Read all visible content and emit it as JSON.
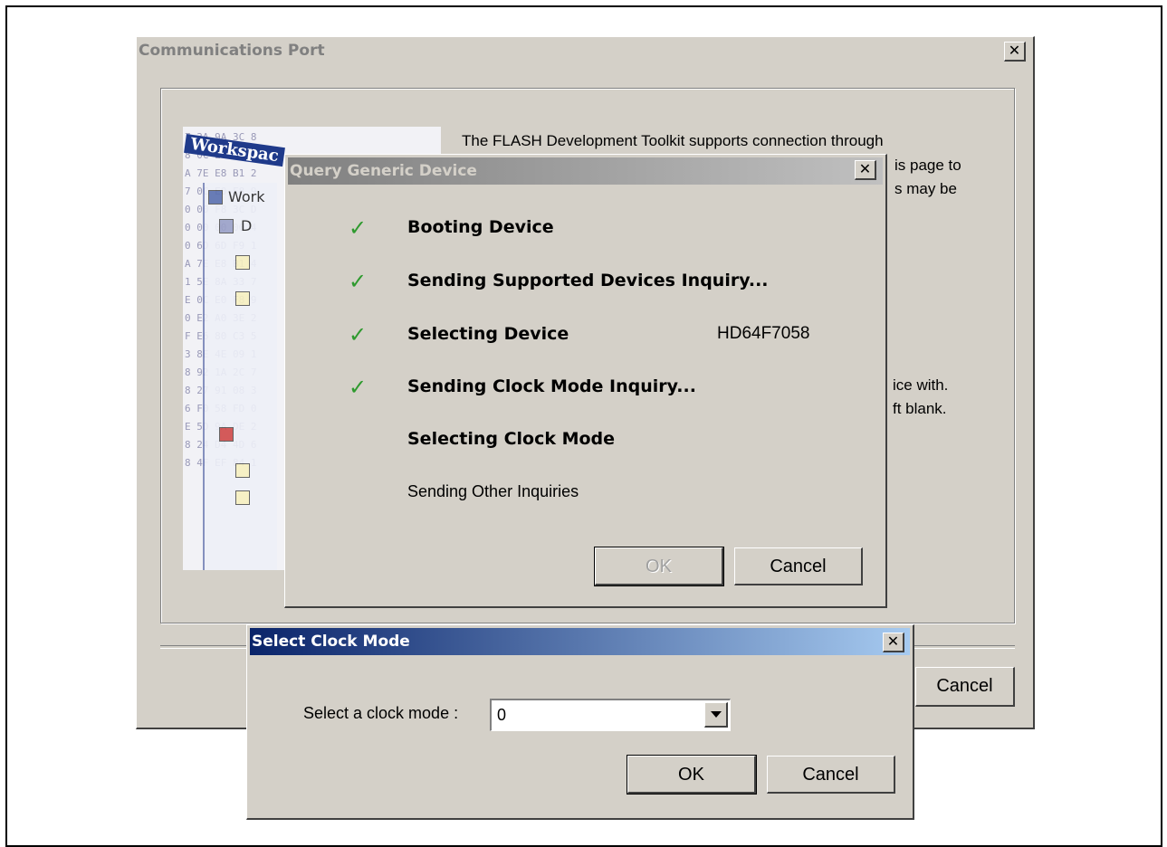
{
  "comm_port": {
    "title": "Communications Port",
    "close_glyph": "✕",
    "description_lines": [
      "The FLASH Development Toolkit supports connection through",
      "is page to",
      "s may be",
      "ice with.",
      "ft blank."
    ],
    "workspace_label": "Workspac",
    "tree_label_1": "Work",
    "tree_label_2": "D",
    "cancel_label": "Cancel"
  },
  "query_dialog": {
    "title": "Query Generic Device",
    "steps": [
      {
        "label": "Booting Device",
        "done": true,
        "bold": true,
        "value": ""
      },
      {
        "label": "Sending Supported Devices Inquiry...",
        "done": true,
        "bold": true,
        "value": ""
      },
      {
        "label": "Selecting Device",
        "done": true,
        "bold": true,
        "value": "HD64F7058"
      },
      {
        "label": "Sending Clock Mode Inquiry...",
        "done": true,
        "bold": true,
        "value": ""
      },
      {
        "label": "Selecting Clock Mode",
        "done": false,
        "bold": true,
        "value": ""
      },
      {
        "label": "Sending Other Inquiries",
        "done": false,
        "bold": false,
        "value": ""
      }
    ],
    "check_glyph": "✓",
    "ok_label": "OK",
    "cancel_label": "Cancel"
  },
  "clock_dialog": {
    "title": "Select Clock Mode",
    "prompt": "Select a clock mode :",
    "selected_value": "0",
    "ok_label": "OK",
    "cancel_label": "Cancel"
  },
  "colors": {
    "dialog_face": "#d4d0c8",
    "active_title_start": "#0a246a",
    "active_title_end": "#a6caf0",
    "check_green": "#2e9a2e"
  }
}
